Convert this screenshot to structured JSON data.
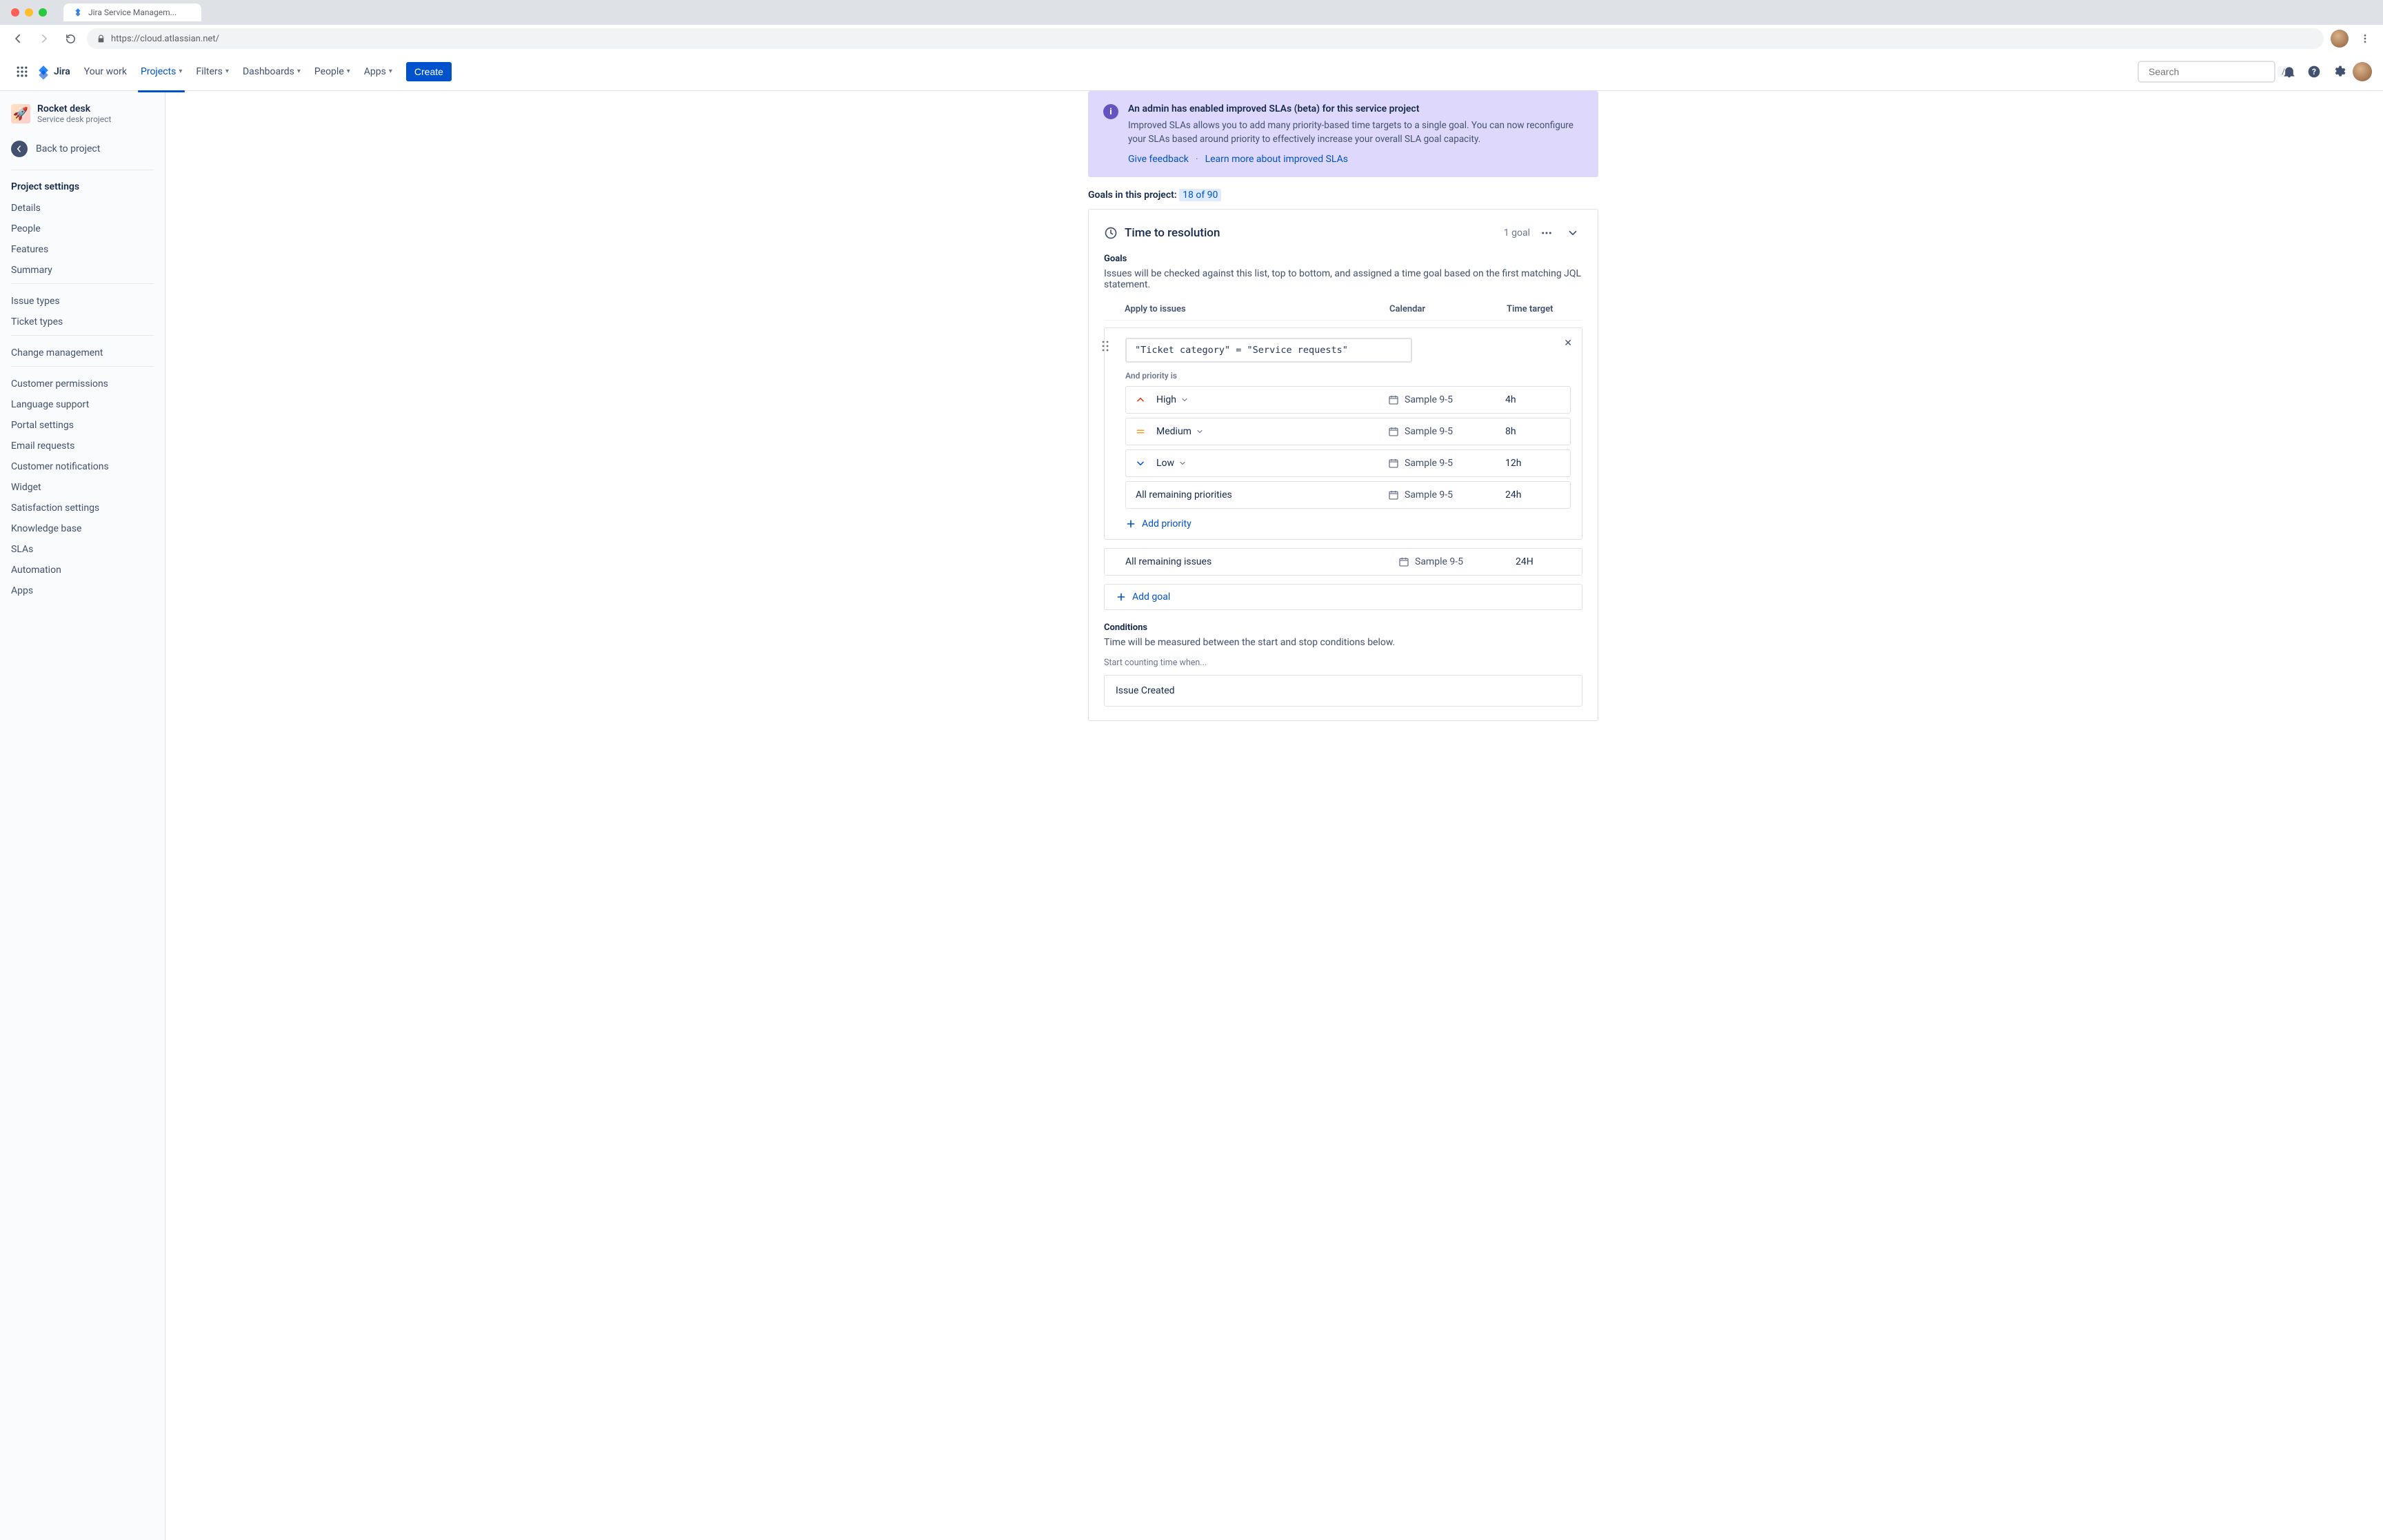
{
  "browser": {
    "tab_title": "Jira Service Managem...",
    "url": "https://cloud.atlassian.net/"
  },
  "header": {
    "product": "Jira",
    "nav": {
      "your_work": "Your work",
      "projects": "Projects",
      "filters": "Filters",
      "dashboards": "Dashboards",
      "people": "People",
      "apps": "Apps"
    },
    "create": "Create",
    "search_placeholder": "Search",
    "search_kbd": "/"
  },
  "sidebar": {
    "project_name": "Rocket desk",
    "project_type": "Service desk project",
    "back_label": "Back to project",
    "settings_heading": "Project settings",
    "group1": {
      "details": "Details",
      "people": "People",
      "features": "Features",
      "summary": "Summary"
    },
    "group2": {
      "issue_types": "Issue types",
      "ticket_types": "Ticket types"
    },
    "group3": {
      "change_mgmt": "Change management"
    },
    "group4": {
      "customer_permissions": "Customer permissions",
      "language_support": "Language support",
      "portal_settings": "Portal settings",
      "email_requests": "Email requests",
      "customer_notifications": "Customer notifications",
      "widget": "Widget",
      "satisfaction_settings": "Satisfaction settings",
      "knowledge_base": "Knowledge base",
      "slas": "SLAs",
      "automation": "Automation",
      "apps": "Apps"
    }
  },
  "banner": {
    "title": "An admin has enabled improved SLAs (beta) for this service project",
    "text": "Improved SLAs allows you to add many priority-based time targets to a single goal. You can now reconfigure your SLAs based around priority to effectively increase your overall SLA goal capacity.",
    "feedback": "Give feedback",
    "learn_more": "Learn more about improved SLAs"
  },
  "goals_summary": {
    "label": "Goals in this project: ",
    "count": "18 of 90"
  },
  "sla_card": {
    "title": "Time to resolution",
    "meta": "1 goal",
    "goals_heading": "Goals",
    "goals_desc": "Issues will be checked against this list, top to bottom, and assigned a time goal based on the first matching JQL statement.",
    "columns": {
      "apply": "Apply to issues",
      "calendar": "Calendar",
      "target": "Time target"
    },
    "jql_value": "\"Ticket category\" = \"Service requests\"",
    "priority_label": "And priority is",
    "priorities": [
      {
        "icon": "high",
        "name": "High",
        "calendar": "Sample 9-5",
        "target": "4h"
      },
      {
        "icon": "medium",
        "name": "Medium",
        "calendar": "Sample 9-5",
        "target": "8h"
      },
      {
        "icon": "low",
        "name": "Low",
        "calendar": "Sample 9-5",
        "target": "12h"
      }
    ],
    "all_remaining_prio": {
      "name": "All remaining priorities",
      "calendar": "Sample 9-5",
      "target": "24h"
    },
    "add_priority": "Add priority",
    "all_remaining_issues": {
      "name": "All remaining issues",
      "calendar": "Sample 9-5",
      "target": "24H"
    },
    "add_goal": "Add goal",
    "conditions_heading": "Conditions",
    "conditions_desc": "Time will be measured between the start and stop conditions below.",
    "start_label": "Start counting time when...",
    "start_condition": "Issue Created"
  }
}
